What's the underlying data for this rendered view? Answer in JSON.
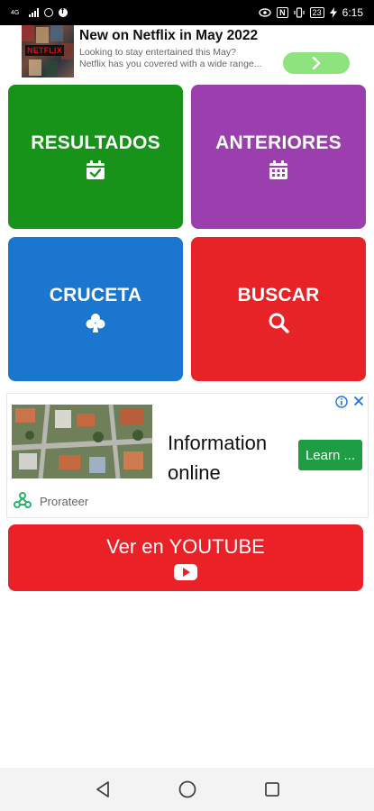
{
  "status_bar": {
    "network_label": "4G",
    "eye_icon": "eye-icon",
    "nfc_label": "N",
    "vibrate_icon": "vibrate-icon",
    "battery_level": "23",
    "time": "6:15"
  },
  "top_ad": {
    "brand": "NETFLIX",
    "title": "New on Netflix in May 2022",
    "line1": "Looking to stay entertained this May?",
    "line2": "Netflix has you covered with a wide range...",
    "cta_icon": "chevron-right-icon"
  },
  "tiles": [
    {
      "label": "RESULTADOS",
      "icon": "calendar-check-icon",
      "color": "#17931a"
    },
    {
      "label": "ANTERIORES",
      "icon": "calendar-icon",
      "color": "#9b3fae"
    },
    {
      "label": "CRUCETA",
      "icon": "club-icon",
      "color": "#1b76cf"
    },
    {
      "label": "BUSCAR",
      "icon": "search-icon",
      "color": "#e62326"
    }
  ],
  "mid_ad": {
    "headline_line1": "Information",
    "headline_line2": "online",
    "cta": "Learn ...",
    "advertiser": "Prorateer",
    "adchoices_icon": "info-icon",
    "close_icon": "close-icon"
  },
  "youtube_button": {
    "label": "Ver en YOUTUBE",
    "icon": "youtube-play-icon",
    "color": "#ea2127"
  },
  "nav_bar": {
    "back_icon": "back-triangle-icon",
    "home_icon": "home-circle-icon",
    "recents_icon": "recents-square-icon"
  }
}
